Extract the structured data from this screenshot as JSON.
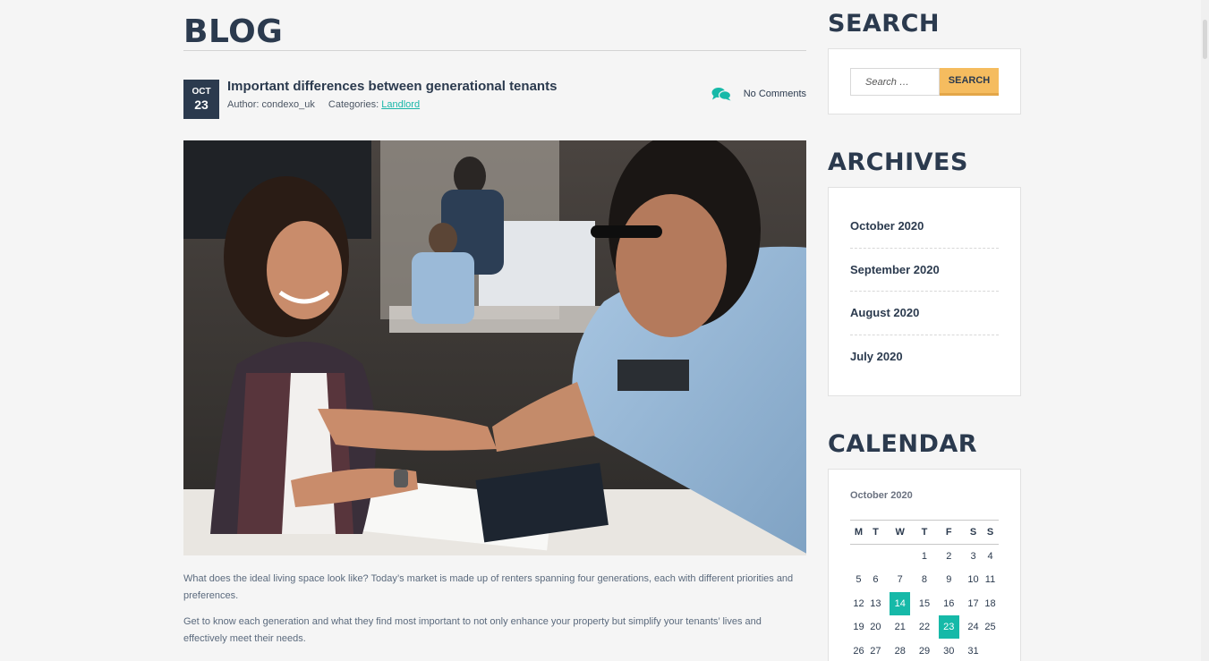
{
  "page": {
    "heading": "BLOG"
  },
  "post": {
    "date_month": "OCT",
    "date_day": "23",
    "title": "Important differences between generational tenants",
    "author_label": "Author:",
    "author": "condexo_uk",
    "categories_label": "Categories:",
    "category": "Landlord",
    "comments": "No Comments",
    "paragraphs": [
      "What does the ideal living space look like? Today’s market is made up of renters spanning four generations, each with different priorities and preferences.",
      "Get to know each generation and what they find most important to not only enhance your property but simplify your tenants’ lives and effectively meet their needs."
    ]
  },
  "sidebar": {
    "search": {
      "title": "SEARCH",
      "placeholder": "Search …",
      "button": "SEARCH"
    },
    "archives": {
      "title": "ARCHIVES",
      "items": [
        "October 2020",
        "September 2020",
        "August 2020",
        "July 2020"
      ]
    },
    "calendar": {
      "title": "CALENDAR",
      "caption": "October 2020",
      "weekdays": [
        "M",
        "T",
        "W",
        "T",
        "F",
        "S",
        "S"
      ],
      "weeks": [
        [
          "",
          "",
          "",
          "1",
          "2",
          "3",
          "4"
        ],
        [
          "5",
          "6",
          "7",
          "8",
          "9",
          "10",
          "11"
        ],
        [
          "12",
          "13",
          "14",
          "15",
          "16",
          "17",
          "18"
        ],
        [
          "19",
          "20",
          "21",
          "22",
          "23",
          "24",
          "25"
        ],
        [
          "26",
          "27",
          "28",
          "29",
          "30",
          "31",
          ""
        ]
      ],
      "highlighted": [
        "14",
        "23"
      ]
    }
  },
  "colors": {
    "navy": "#2b3a4e",
    "teal": "#16b9a8",
    "amber": "#f5bc5f",
    "background": "#f5f5f5"
  },
  "icons": {
    "comments": "comments-icon"
  }
}
